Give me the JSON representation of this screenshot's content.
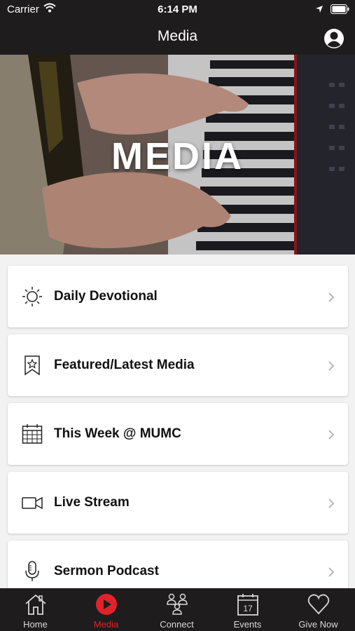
{
  "status_bar": {
    "carrier": "Carrier",
    "time": "6:14 PM"
  },
  "nav": {
    "title": "Media",
    "profile_icon": "person-circle-icon"
  },
  "hero": {
    "title": "MEDIA"
  },
  "menu": {
    "items": [
      {
        "label": "Daily Devotional",
        "icon": "sun-icon"
      },
      {
        "label": "Featured/Latest Media",
        "icon": "bookmark-star-icon"
      },
      {
        "label": "This Week @ MUMC",
        "icon": "calendar-grid-icon"
      },
      {
        "label": "Live Stream",
        "icon": "video-camera-icon"
      },
      {
        "label": "Sermon Podcast",
        "icon": "microphone-icon"
      }
    ]
  },
  "tabs": {
    "active": "Media",
    "items": [
      {
        "label": "Home",
        "icon": "home-icon"
      },
      {
        "label": "Media",
        "icon": "play-circle-icon"
      },
      {
        "label": "Connect",
        "icon": "people-connect-icon"
      },
      {
        "label": "Events",
        "icon": "calendar-icon",
        "icon_text": "17"
      },
      {
        "label": "Give Now",
        "icon": "heart-icon"
      }
    ]
  },
  "colors": {
    "bar": "#1e1c1c",
    "accent": "#e0232b",
    "background": "#f2f2f2"
  }
}
